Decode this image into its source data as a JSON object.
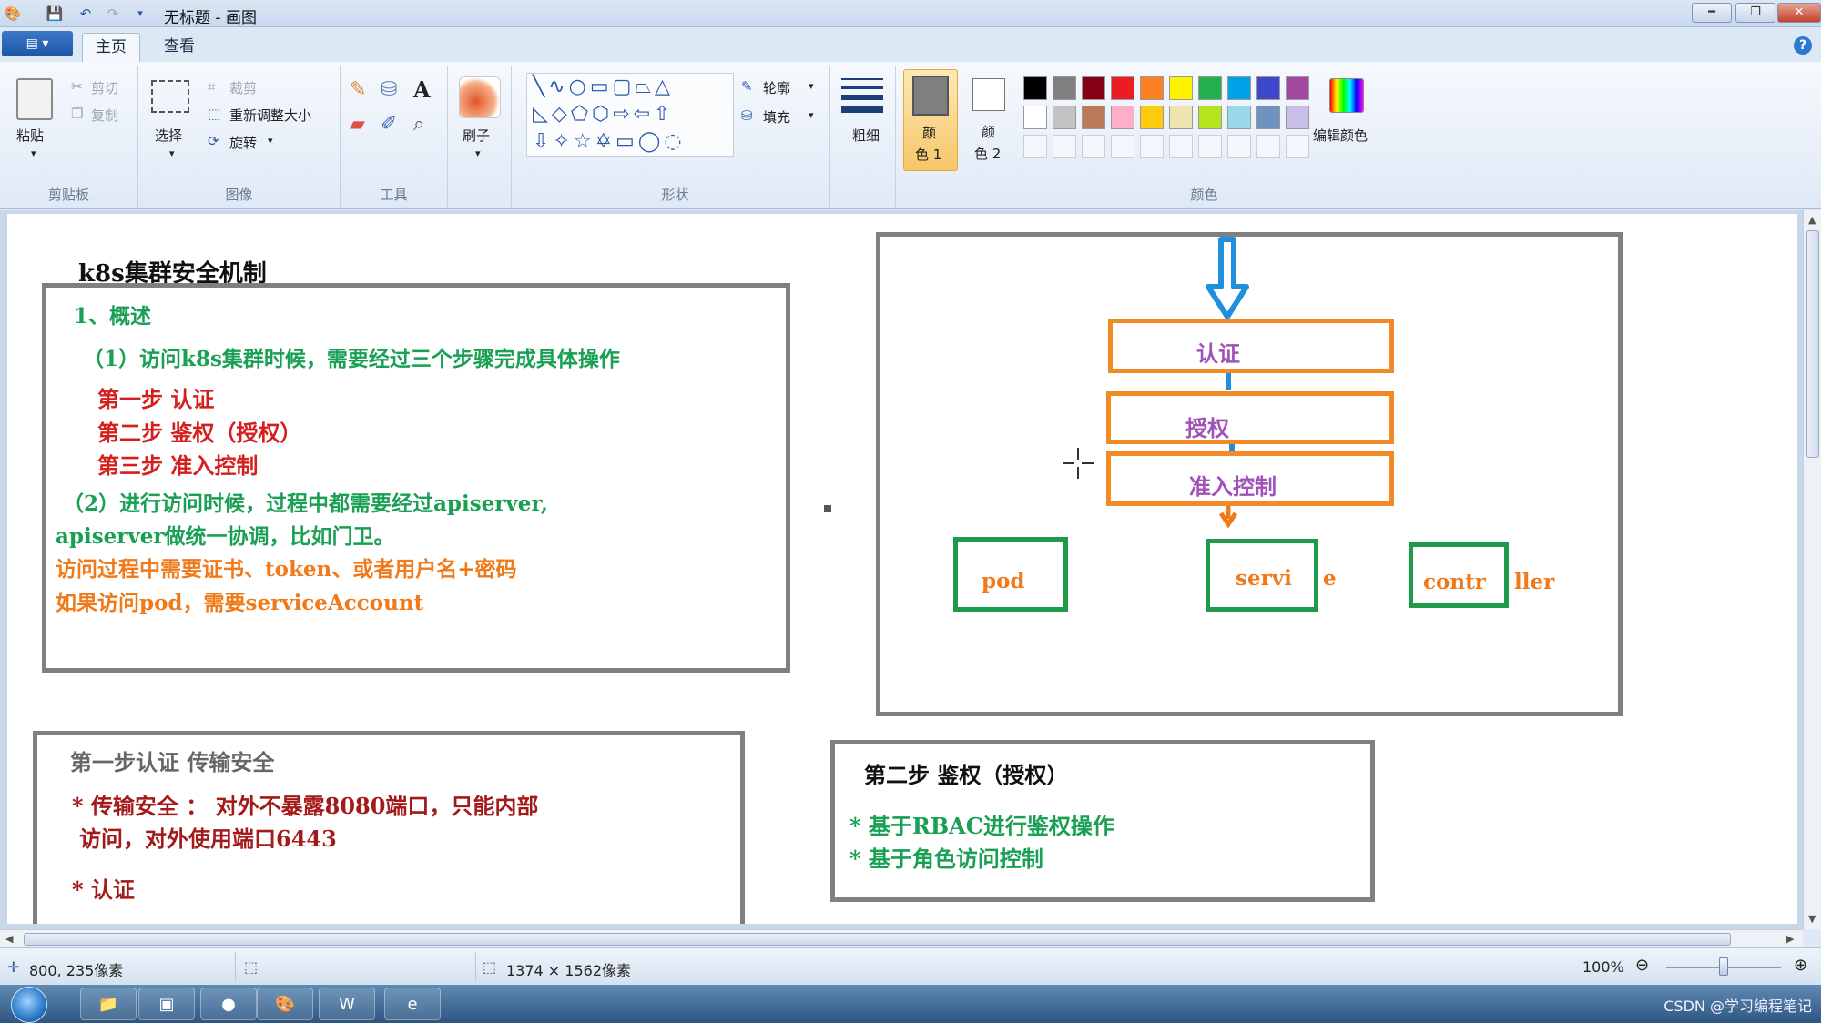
{
  "window": {
    "title": "无标题 - 画图",
    "min_label": "━",
    "max_label": "❐",
    "close_label": "✕"
  },
  "menu": {
    "file_label": "▤ ▾",
    "tabs": [
      "主页",
      "查看"
    ],
    "help": "?"
  },
  "ribbon": {
    "clipboard": {
      "label": "剪贴板",
      "paste": "粘贴",
      "cut": "剪切",
      "copy": "复制"
    },
    "image": {
      "label": "图像",
      "select": "选择",
      "crop": "裁剪",
      "resize": "重新调整大小",
      "rotate": "旋转"
    },
    "tools": {
      "label": "工具"
    },
    "brush": {
      "label": "刷子"
    },
    "shapes": {
      "label": "形状",
      "outline": "轮廓",
      "fill": "填充"
    },
    "size": {
      "label": "粗细"
    },
    "color1": {
      "label_1": "颜",
      "label_2": "色 1"
    },
    "color2": {
      "label_1": "颜",
      "label_2": "色 2"
    },
    "colors": {
      "label": "颜色",
      "edit": "编辑颜色",
      "row1": [
        "#000000",
        "#7f7f7f",
        "#880015",
        "#ed1c24",
        "#ff7f27",
        "#fff200",
        "#22b14c",
        "#00a2e8",
        "#3f48cc",
        "#a349a4"
      ],
      "row2": [
        "#ffffff",
        "#c3c3c3",
        "#b97a57",
        "#ffaec9",
        "#ffc90e",
        "#efe4b0",
        "#b5e61d",
        "#99d9ea",
        "#7092be",
        "#c8bfe7"
      ]
    }
  },
  "canvas": {
    "title": "k8s集群安全机制",
    "overview": {
      "heading": "1、概述",
      "p1": "（1）访问k8s集群时候，需要经过三个步骤完成具体操作",
      "step1": "第一步  认证",
      "step2": "第二步  鉴权（授权）",
      "step3": "第三步  准入控制",
      "p2a": "（2）进行访问时候，过程中都需要经过apiserver,",
      "p2b": "apiserver做统一协调，比如门卫。",
      "p3": "访问过程中需要证书、token、或者用户名+密码",
      "p4": "如果访问pod，需要serviceAccount"
    },
    "flow": {
      "auth": "认证",
      "authz": "授权",
      "admission": "准入控制",
      "pod": "pod",
      "service": "servi",
      "service_tail": "e",
      "controller": "contr",
      "controller_tail": "ller"
    },
    "step1box": {
      "heading": "第一步认证  传输安全",
      "b1": "*  传输安全  ：   对外不暴露8080端口，只能内部",
      "b1b": "访问，对外使用端口6443",
      "b2": "*  认证"
    },
    "step2box": {
      "heading": "第二步  鉴权（授权）",
      "b1": "*  基于RBAC进行鉴权操作",
      "b2": "*  基于角色访问控制"
    }
  },
  "status": {
    "cursor": "800, 235像素",
    "size": "1374 × 1562像素",
    "zoom": "100%"
  },
  "taskbar": {
    "watermark": "CSDN @学习编程笔记"
  }
}
